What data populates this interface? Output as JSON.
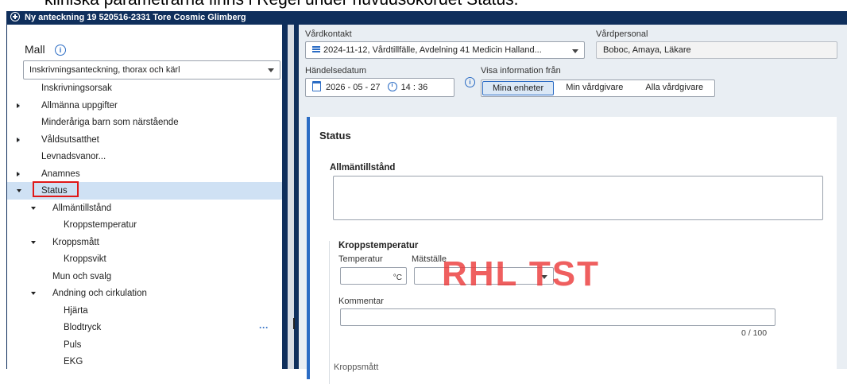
{
  "caption": "kliniska parametrarna finns i Regel under huvudsökordet Status.",
  "window": {
    "title": "Ny anteckning 19 520516-2331 Tore Cosmic Glimberg"
  },
  "left_panel": {
    "mall_label": "Mall",
    "mall_value": "Inskrivningsanteckning, thorax och kärl",
    "tree": [
      {
        "label": "Inskrivningsorsak",
        "level": 0,
        "arrow": ""
      },
      {
        "label": "Allmänna uppgifter",
        "level": 0,
        "arrow": "right"
      },
      {
        "label": "Minderåriga barn som närstående",
        "level": 0,
        "arrow": ""
      },
      {
        "label": "Våldsutsatthet",
        "level": 0,
        "arrow": "right"
      },
      {
        "label": "Levnadsvanor...",
        "level": 0,
        "arrow": ""
      },
      {
        "label": "Anamnes",
        "level": 0,
        "arrow": "right"
      },
      {
        "label": "Status",
        "level": 0,
        "arrow": "down",
        "selected": true
      },
      {
        "label": "Allmäntillstånd",
        "level": 1,
        "arrow": "down"
      },
      {
        "label": "Kroppstemperatur",
        "level": 2,
        "arrow": ""
      },
      {
        "label": "Kroppsmått",
        "level": 1,
        "arrow": "down"
      },
      {
        "label": "Kroppsvikt",
        "level": 2,
        "arrow": ""
      },
      {
        "label": "Mun och svalg",
        "level": 1,
        "arrow": ""
      },
      {
        "label": "Andning och cirkulation",
        "level": 1,
        "arrow": "down"
      },
      {
        "label": "Hjärta",
        "level": 2,
        "arrow": ""
      },
      {
        "label": "Blodtryck",
        "level": 2,
        "arrow": "",
        "more": "···"
      },
      {
        "label": "Puls",
        "level": 2,
        "arrow": ""
      },
      {
        "label": "EKG",
        "level": 2,
        "arrow": ""
      }
    ]
  },
  "header": {
    "vardkontakt_label": "Vårdkontakt",
    "vardkontakt_value": "2024-11-12, Vårdtillfälle, Avdelning 41 Medicin Halland...",
    "vardpersonal_label": "Vårdpersonal",
    "vardpersonal_value": "Boboc, Amaya, Läkare",
    "handelsedatum_label": "Händelsedatum",
    "date_value": "2026 - 05 - 27",
    "time_value": "14 : 36",
    "visa_label": "Visa information från",
    "visa_options": [
      "Mina enheter",
      "Min vårdgivare",
      "Alla vårdgivare"
    ],
    "visa_selected": "Mina enheter"
  },
  "form": {
    "section_title": "Status",
    "allmantillstand_label": "Allmäntillstånd",
    "kroppstemperatur_label": "Kroppstemperatur",
    "temperatur_label": "Temperatur",
    "temperatur_unit": "°C",
    "matstalle_label": "Mätställe",
    "kommentar_label": "Kommentar",
    "kommentar_counter": "0 / 100",
    "next_section_partial": "Kroppsmått"
  },
  "watermark": "RHL TST",
  "colors": {
    "titlebar": "#0f2f5c",
    "accent": "#2b6cc4",
    "selected_row": "#cfe1f4",
    "highlight_box": "#e01818",
    "watermark": "#ec3c3c"
  }
}
